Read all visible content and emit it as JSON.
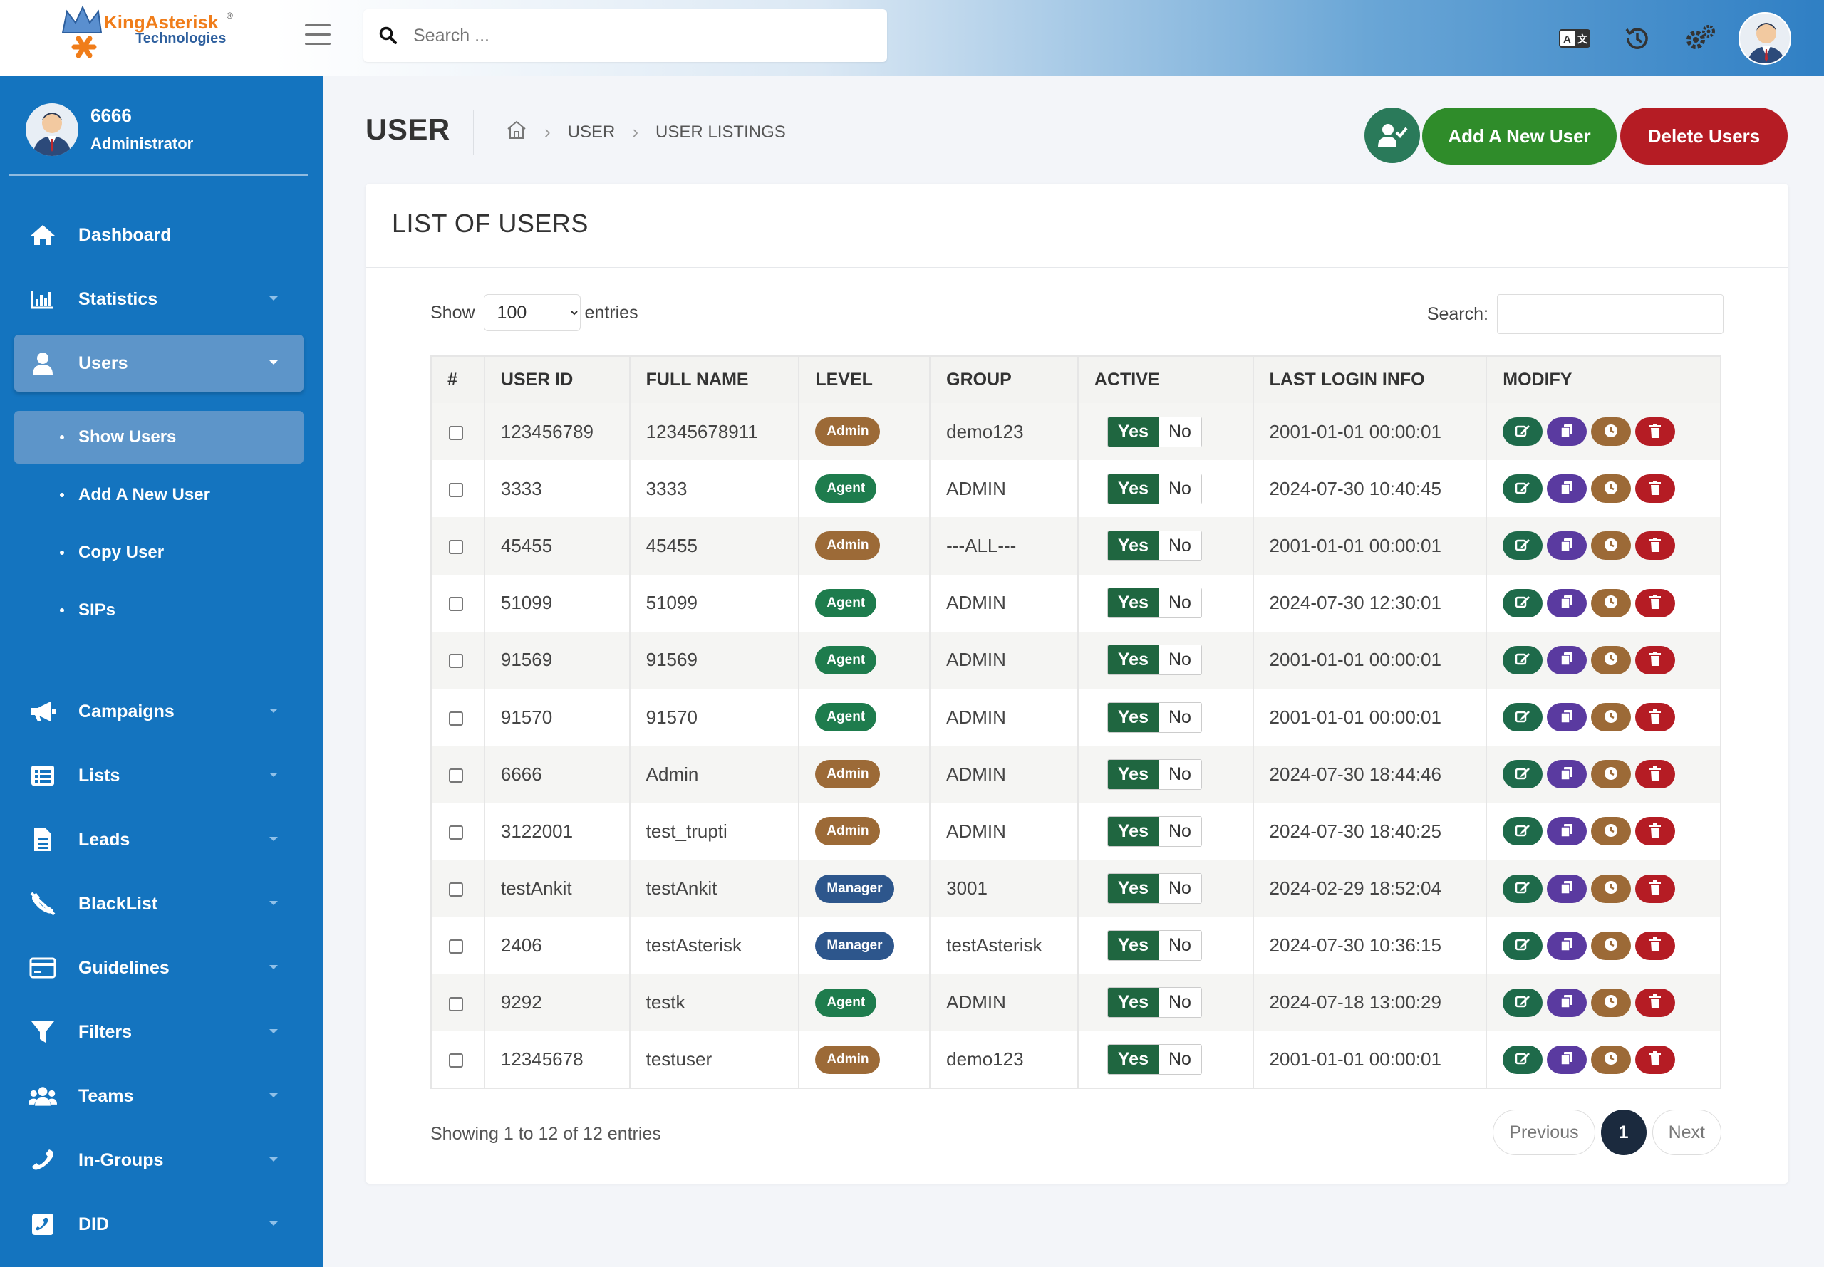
{
  "brand": {
    "name": "KingAsterisk",
    "sub": "Technologies",
    "reg": "®"
  },
  "search": {
    "placeholder": "Search ..."
  },
  "topbar_icons": [
    "translate-icon",
    "history-icon",
    "settings-icon"
  ],
  "profile": {
    "username": "6666",
    "role": "Administrator"
  },
  "sidebar": {
    "items": [
      {
        "label": "Dashboard",
        "icon": "home-icon"
      },
      {
        "label": "Statistics",
        "icon": "bar-chart-icon"
      },
      {
        "label": "Users",
        "icon": "user-icon",
        "active": true
      },
      {
        "label": "Campaigns",
        "icon": "megaphone-icon"
      },
      {
        "label": "Lists",
        "icon": "list-icon"
      },
      {
        "label": "Leads",
        "icon": "document-icon"
      },
      {
        "label": "BlackList",
        "icon": "phone-slash-icon"
      },
      {
        "label": "Guidelines",
        "icon": "card-icon"
      },
      {
        "label": "Filters",
        "icon": "filter-icon"
      },
      {
        "label": "Teams",
        "icon": "team-icon"
      },
      {
        "label": "In-Groups",
        "icon": "phone-icon"
      },
      {
        "label": "DID",
        "icon": "phone-square-icon"
      }
    ],
    "users_sub": [
      {
        "label": "Show Users",
        "active": true
      },
      {
        "label": "Add A New User"
      },
      {
        "label": "Copy User"
      },
      {
        "label": "SIPs"
      }
    ]
  },
  "header": {
    "title": "USER",
    "breadcrumb": [
      "USER",
      "USER LISTINGS"
    ],
    "add_label": "Add A New User",
    "delete_label": "Delete Users"
  },
  "card": {
    "title": "LIST OF USERS",
    "show_label": "Show",
    "entries_label": "entries",
    "page_size": "100",
    "search_label": "Search:"
  },
  "table": {
    "columns": [
      "#",
      "USER ID",
      "FULL NAME",
      "LEVEL",
      "GROUP",
      "ACTIVE",
      "LAST LOGIN INFO",
      "MODIFY"
    ],
    "yes_label": "Yes",
    "no_label": "No",
    "rows": [
      {
        "user_id": "123456789",
        "full_name": "12345678911",
        "level": "Admin",
        "group": "demo123",
        "last_login": "2001-01-01 00:00:01"
      },
      {
        "user_id": "3333",
        "full_name": "3333",
        "level": "Agent",
        "group": "ADMIN",
        "last_login": "2024-07-30 10:40:45"
      },
      {
        "user_id": "45455",
        "full_name": "45455",
        "level": "Admin",
        "group": "---ALL---",
        "last_login": "2001-01-01 00:00:01"
      },
      {
        "user_id": "51099",
        "full_name": "51099",
        "level": "Agent",
        "group": "ADMIN",
        "last_login": "2024-07-30 12:30:01"
      },
      {
        "user_id": "91569",
        "full_name": "91569",
        "level": "Agent",
        "group": "ADMIN",
        "last_login": "2001-01-01 00:00:01"
      },
      {
        "user_id": "91570",
        "full_name": "91570",
        "level": "Agent",
        "group": "ADMIN",
        "last_login": "2001-01-01 00:00:01"
      },
      {
        "user_id": "6666",
        "full_name": "Admin",
        "level": "Admin",
        "group": "ADMIN",
        "last_login": "2024-07-30 18:44:46"
      },
      {
        "user_id": "3122001",
        "full_name": "test_trupti",
        "level": "Admin",
        "group": "ADMIN",
        "last_login": "2024-07-30 18:40:25"
      },
      {
        "user_id": "testAnkit",
        "full_name": "testAnkit",
        "level": "Manager",
        "group": "3001",
        "last_login": "2024-02-29 18:52:04"
      },
      {
        "user_id": "2406",
        "full_name": "testAsterisk",
        "level": "Manager",
        "group": "testAsterisk",
        "last_login": "2024-07-30 10:36:15"
      },
      {
        "user_id": "9292",
        "full_name": "testk",
        "level": "Agent",
        "group": "ADMIN",
        "last_login": "2024-07-18 13:00:29"
      },
      {
        "user_id": "12345678",
        "full_name": "testuser",
        "level": "Admin",
        "group": "demo123",
        "last_login": "2001-01-01 00:00:01"
      }
    ]
  },
  "footer": {
    "showing": "Showing 1 to 12 of 12 entries",
    "prev": "Previous",
    "page": "1",
    "next": "Next"
  },
  "colors": {
    "sidebar": "#1474bf",
    "add_button": "#2f8c2a",
    "delete_button": "#b51c24",
    "admin_badge": "#9c6a37",
    "agent_badge": "#1e7c4d",
    "manager_badge": "#2d568c"
  }
}
